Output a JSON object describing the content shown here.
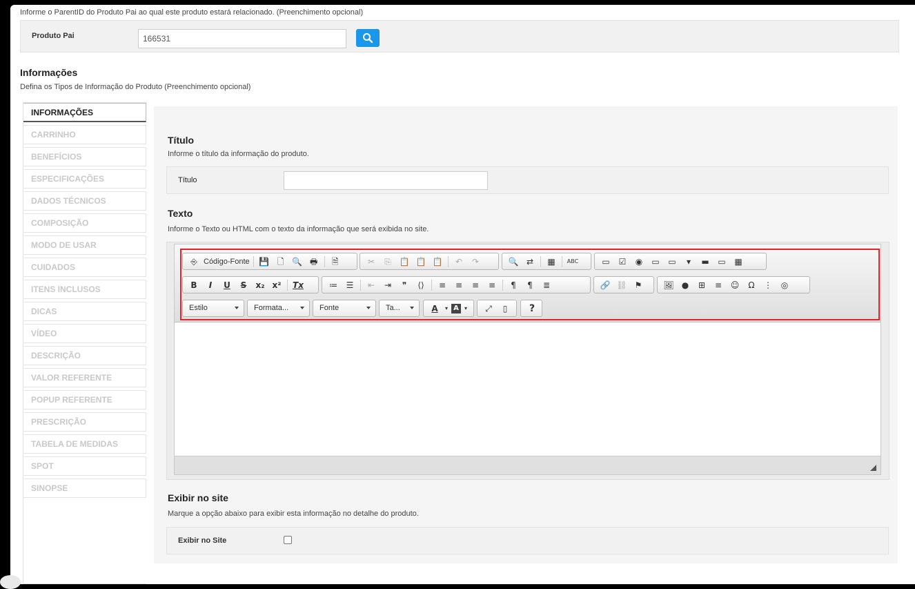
{
  "top_note": "Informe o ParentID do Produto Pai ao qual este produto estará relacionado. (Preenchimento opcional)",
  "parent": {
    "label": "Produto Pai",
    "value": "166531"
  },
  "info_section": {
    "title": "Informações",
    "subtitle": "Defina os Tipos de Informação do Produto (Preenchimento opcional)"
  },
  "tabs": [
    {
      "label": "INFORMAÇÕES"
    },
    {
      "label": "CARRINHO"
    },
    {
      "label": "BENEFÍCIOS"
    },
    {
      "label": "ESPECIFICAÇÕES"
    },
    {
      "label": "DADOS TÉCNICOS"
    },
    {
      "label": "COMPOSIÇÃO"
    },
    {
      "label": "MODO DE USAR"
    },
    {
      "label": "CUIDADOS"
    },
    {
      "label": "ITENS INCLUSOS"
    },
    {
      "label": "DICAS"
    },
    {
      "label": "VÍDEO"
    },
    {
      "label": "DESCRIÇÃO"
    },
    {
      "label": "VALOR REFERENTE"
    },
    {
      "label": "POPUP REFERENTE"
    },
    {
      "label": "PRESCRIÇÃO"
    },
    {
      "label": "TABELA DE MEDIDAS"
    },
    {
      "label": "SPOT"
    },
    {
      "label": "SINOPSE"
    }
  ],
  "titulo": {
    "title": "Título",
    "subtitle": "Informe o título da informação do produto.",
    "label": "Título",
    "value": ""
  },
  "texto": {
    "title": "Texto",
    "subtitle": "Informe o Texto ou HTML com o texto da informação que será exibida no site."
  },
  "toolbar": {
    "source_label": "Código-Fonte",
    "row1_file": [
      "💾",
      "🗋",
      "🔍",
      "🖶",
      "🗎"
    ],
    "row1_clip": [
      "✂",
      "⎘",
      "📋",
      "📋",
      "📋",
      "↶",
      "↷"
    ],
    "row1_find": [
      "🔍",
      "⇄",
      "▦",
      "ABC"
    ],
    "row1_forms": [
      "▭",
      "☑",
      "◉",
      "▭",
      "▭",
      "▾",
      "▬",
      "▭",
      "▦"
    ],
    "bold": "B",
    "italic": "I",
    "underline": "U",
    "strike": "S",
    "subscript": "x₂",
    "superscript": "x²",
    "clear": "Tx",
    "row2_list": [
      "≔",
      "☰",
      "⇤",
      "⇥",
      "❞",
      "⟨⟩",
      "≡",
      "≡",
      "≡",
      "≡",
      "¶",
      "¶",
      "≣"
    ],
    "row2_link": [
      "🔗",
      "⛓",
      "⚑"
    ],
    "row2_insert": [
      "🖼",
      "●",
      "⊞",
      "≡",
      "☺",
      "Ω",
      "⋮",
      "◎"
    ],
    "style_combo": "Estilo",
    "format_combo": "Formata...",
    "font_combo": "Fonte",
    "size_combo": "Ta...",
    "text_color": "A",
    "bg_color": "A",
    "maximize": "⤢",
    "blocks": "▯",
    "help": "?"
  },
  "exibir": {
    "title": "Exibir no site",
    "subtitle": "Marque a opção abaixo para exibir esta informação no detalhe do produto.",
    "label": "Exibir no Site",
    "checked": false
  }
}
